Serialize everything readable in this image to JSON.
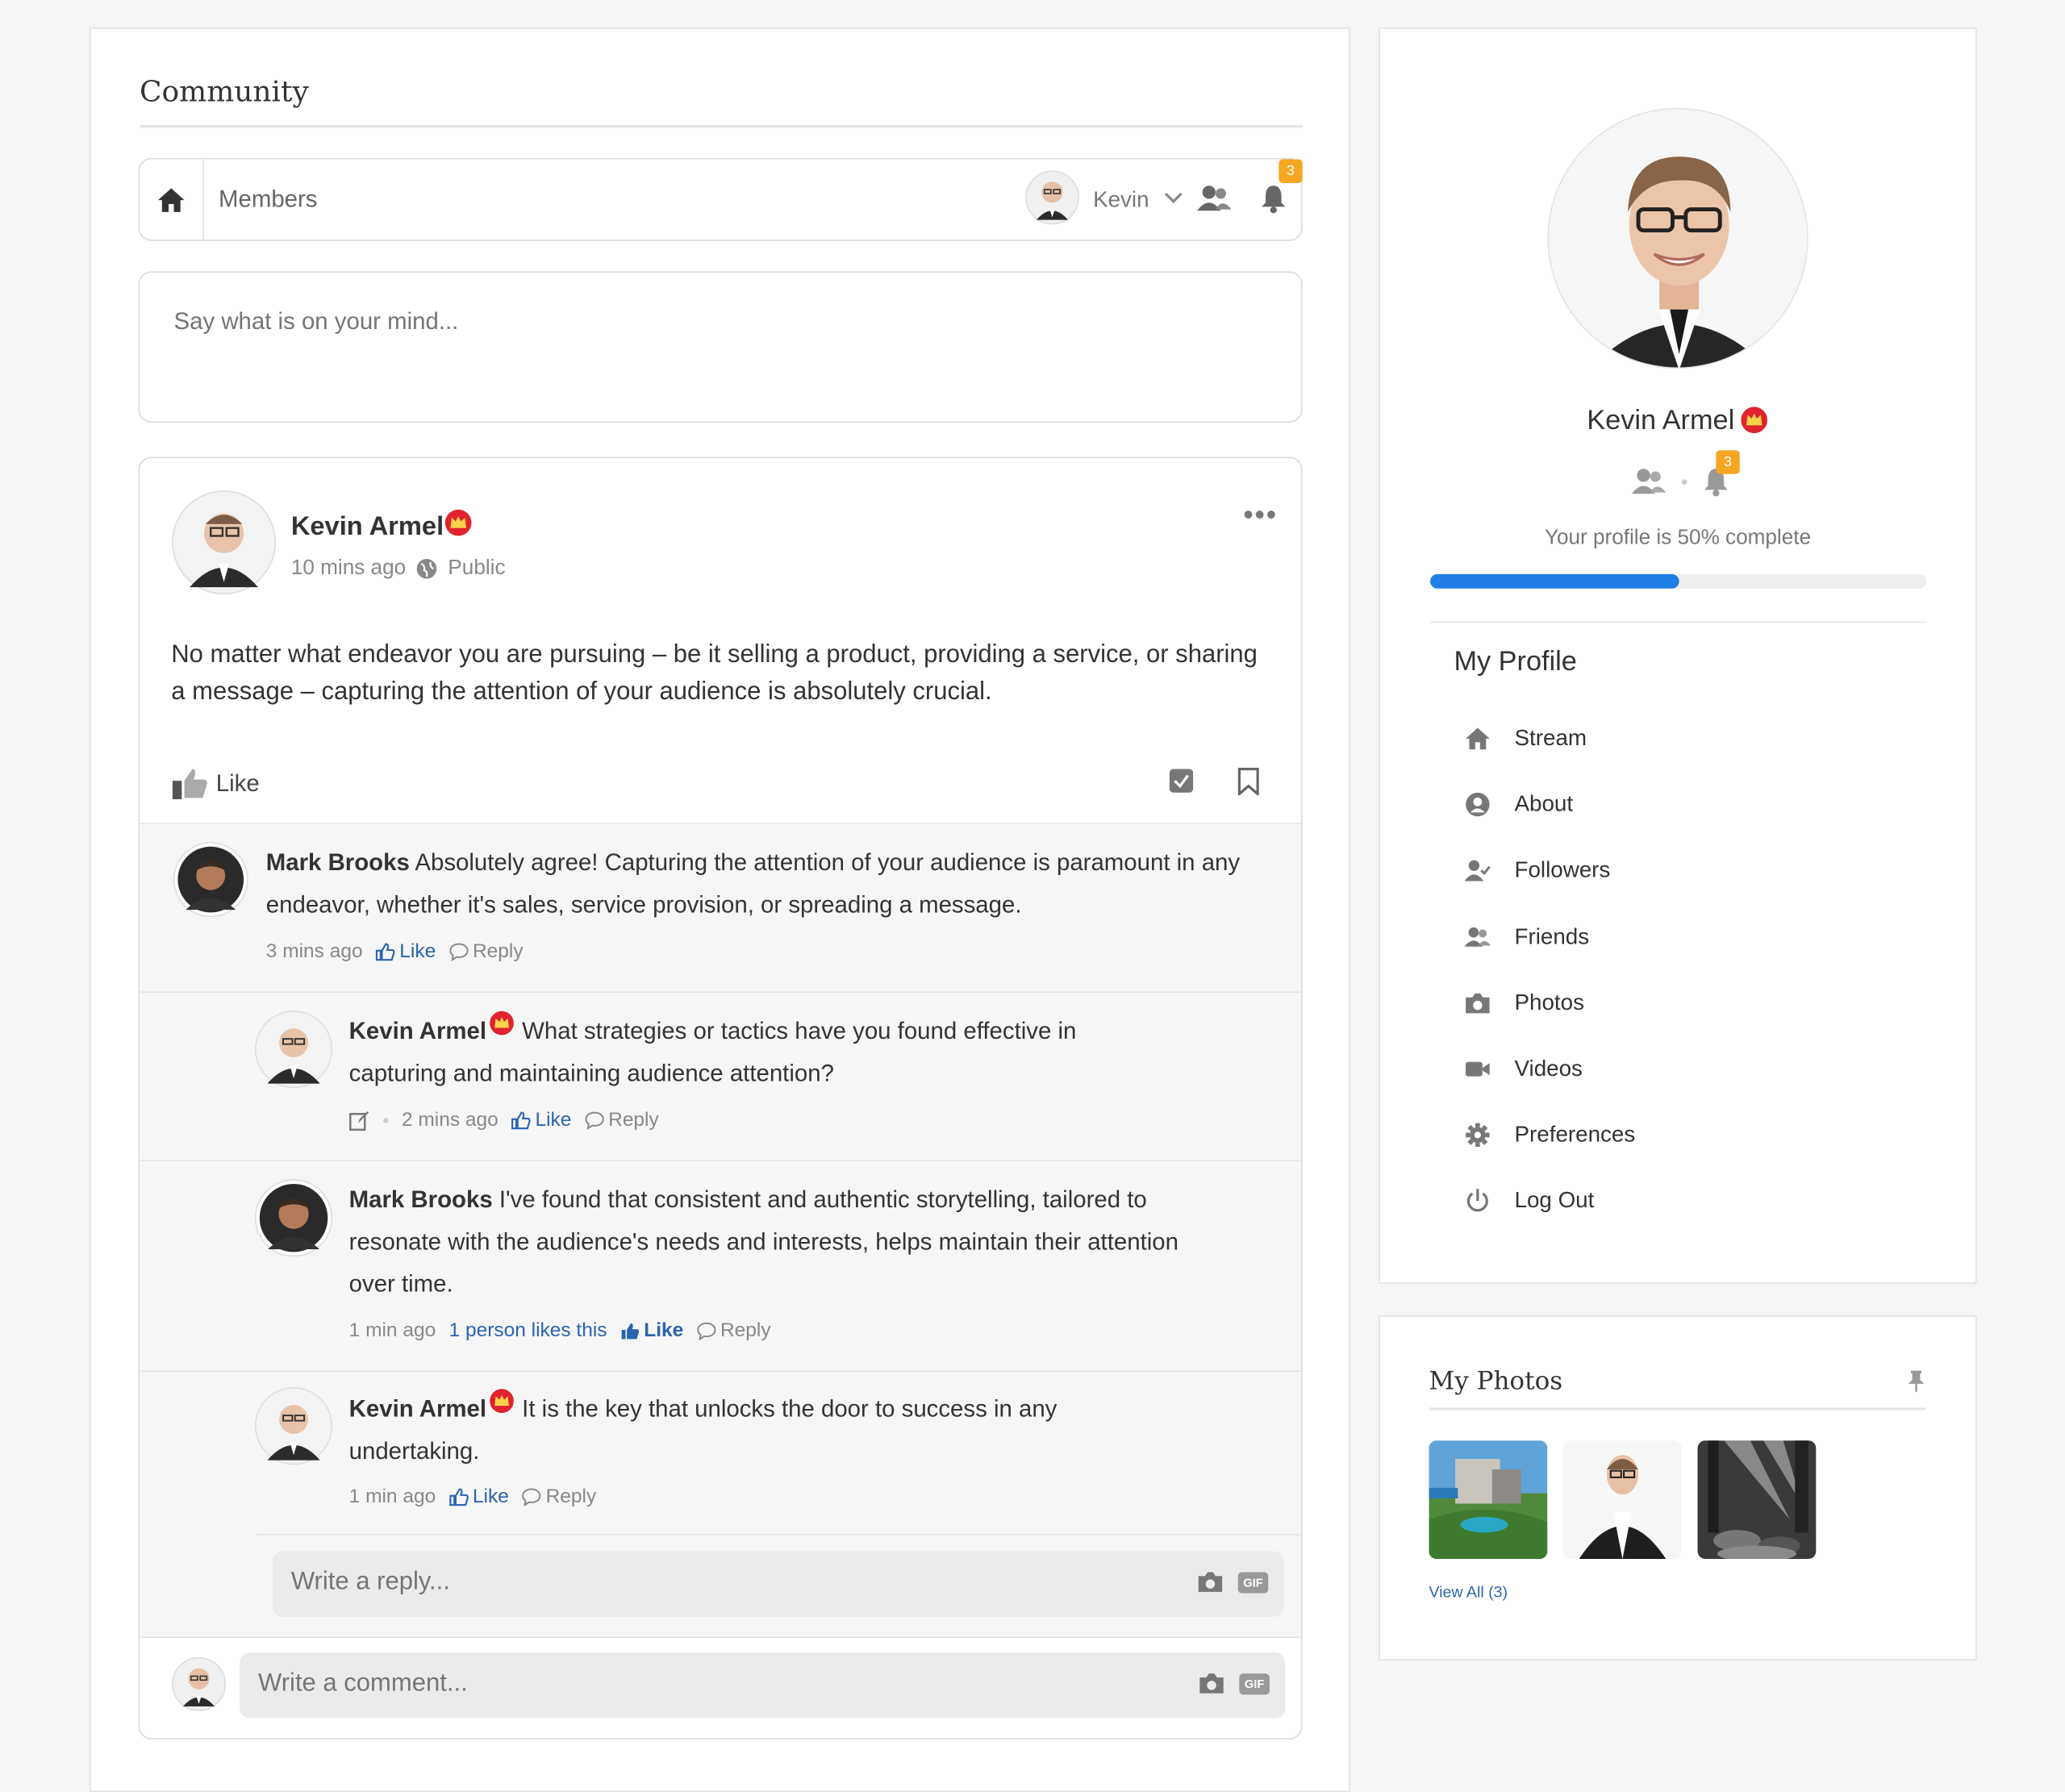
{
  "page": {
    "title": "Community"
  },
  "toolbar": {
    "members_label": "Members",
    "user_name": "Kevin",
    "notification_count": "3"
  },
  "composer": {
    "placeholder": "Say what is on your mind..."
  },
  "post": {
    "author": "Kevin Armel",
    "time": "10 mins ago",
    "privacy": "Public",
    "body": "No matter what endeavor you are pursuing – be it selling a product, providing a service, or sharing a message – capturing the attention of your audience is absolutely crucial.",
    "like_label": "Like"
  },
  "comments": [
    {
      "author": "Mark Brooks",
      "text": "Absolutely agree! Capturing the attention of your audience is paramount in any endeavor, whether it's sales, service provision, or spreading a message.",
      "time": "3 mins ago",
      "like": "Like",
      "reply": "Reply"
    },
    {
      "author": "Kevin Armel",
      "text": "What strategies or tactics have you found effective in capturing and maintaining audience attention?",
      "time": "2 mins ago",
      "like": "Like",
      "reply": "Reply"
    },
    {
      "author": "Mark Brooks",
      "text": "I've found that consistent and authentic storytelling, tailored to resonate with the audience's needs and interests, helps maintain their attention over time.",
      "time": "1 min ago",
      "likes_summary": "1 person likes this",
      "like": "Like",
      "reply": "Reply"
    },
    {
      "author": "Kevin Armel",
      "text": "It is the key that unlocks the door to success in any undertaking.",
      "time": "1 min ago",
      "like": "Like",
      "reply": "Reply"
    }
  ],
  "reply_box": {
    "placeholder": "Write a reply...",
    "gif_label": "GIF"
  },
  "comment_box": {
    "placeholder": "Write a comment...",
    "gif_label": "GIF"
  },
  "profile": {
    "name": "Kevin Armel",
    "notification_count": "3",
    "completion_text": "Your profile is 50% complete",
    "completion_fraction": 0.5,
    "menu_title": "My Profile",
    "menu": [
      {
        "label": "Stream",
        "icon": "home-icon"
      },
      {
        "label": "About",
        "icon": "user-circle-icon"
      },
      {
        "label": "Followers",
        "icon": "user-check-icon"
      },
      {
        "label": "Friends",
        "icon": "users-icon"
      },
      {
        "label": "Photos",
        "icon": "camera-icon"
      },
      {
        "label": "Videos",
        "icon": "video-icon"
      },
      {
        "label": "Preferences",
        "icon": "gear-icon"
      },
      {
        "label": "Log Out",
        "icon": "power-icon"
      }
    ]
  },
  "photos": {
    "title": "My Photos",
    "view_all": "View All (3)"
  },
  "colors": {
    "accent": "#1e7ee6",
    "badge": "#f5a623",
    "link": "#2b64b0",
    "crown": "#e0232e"
  }
}
